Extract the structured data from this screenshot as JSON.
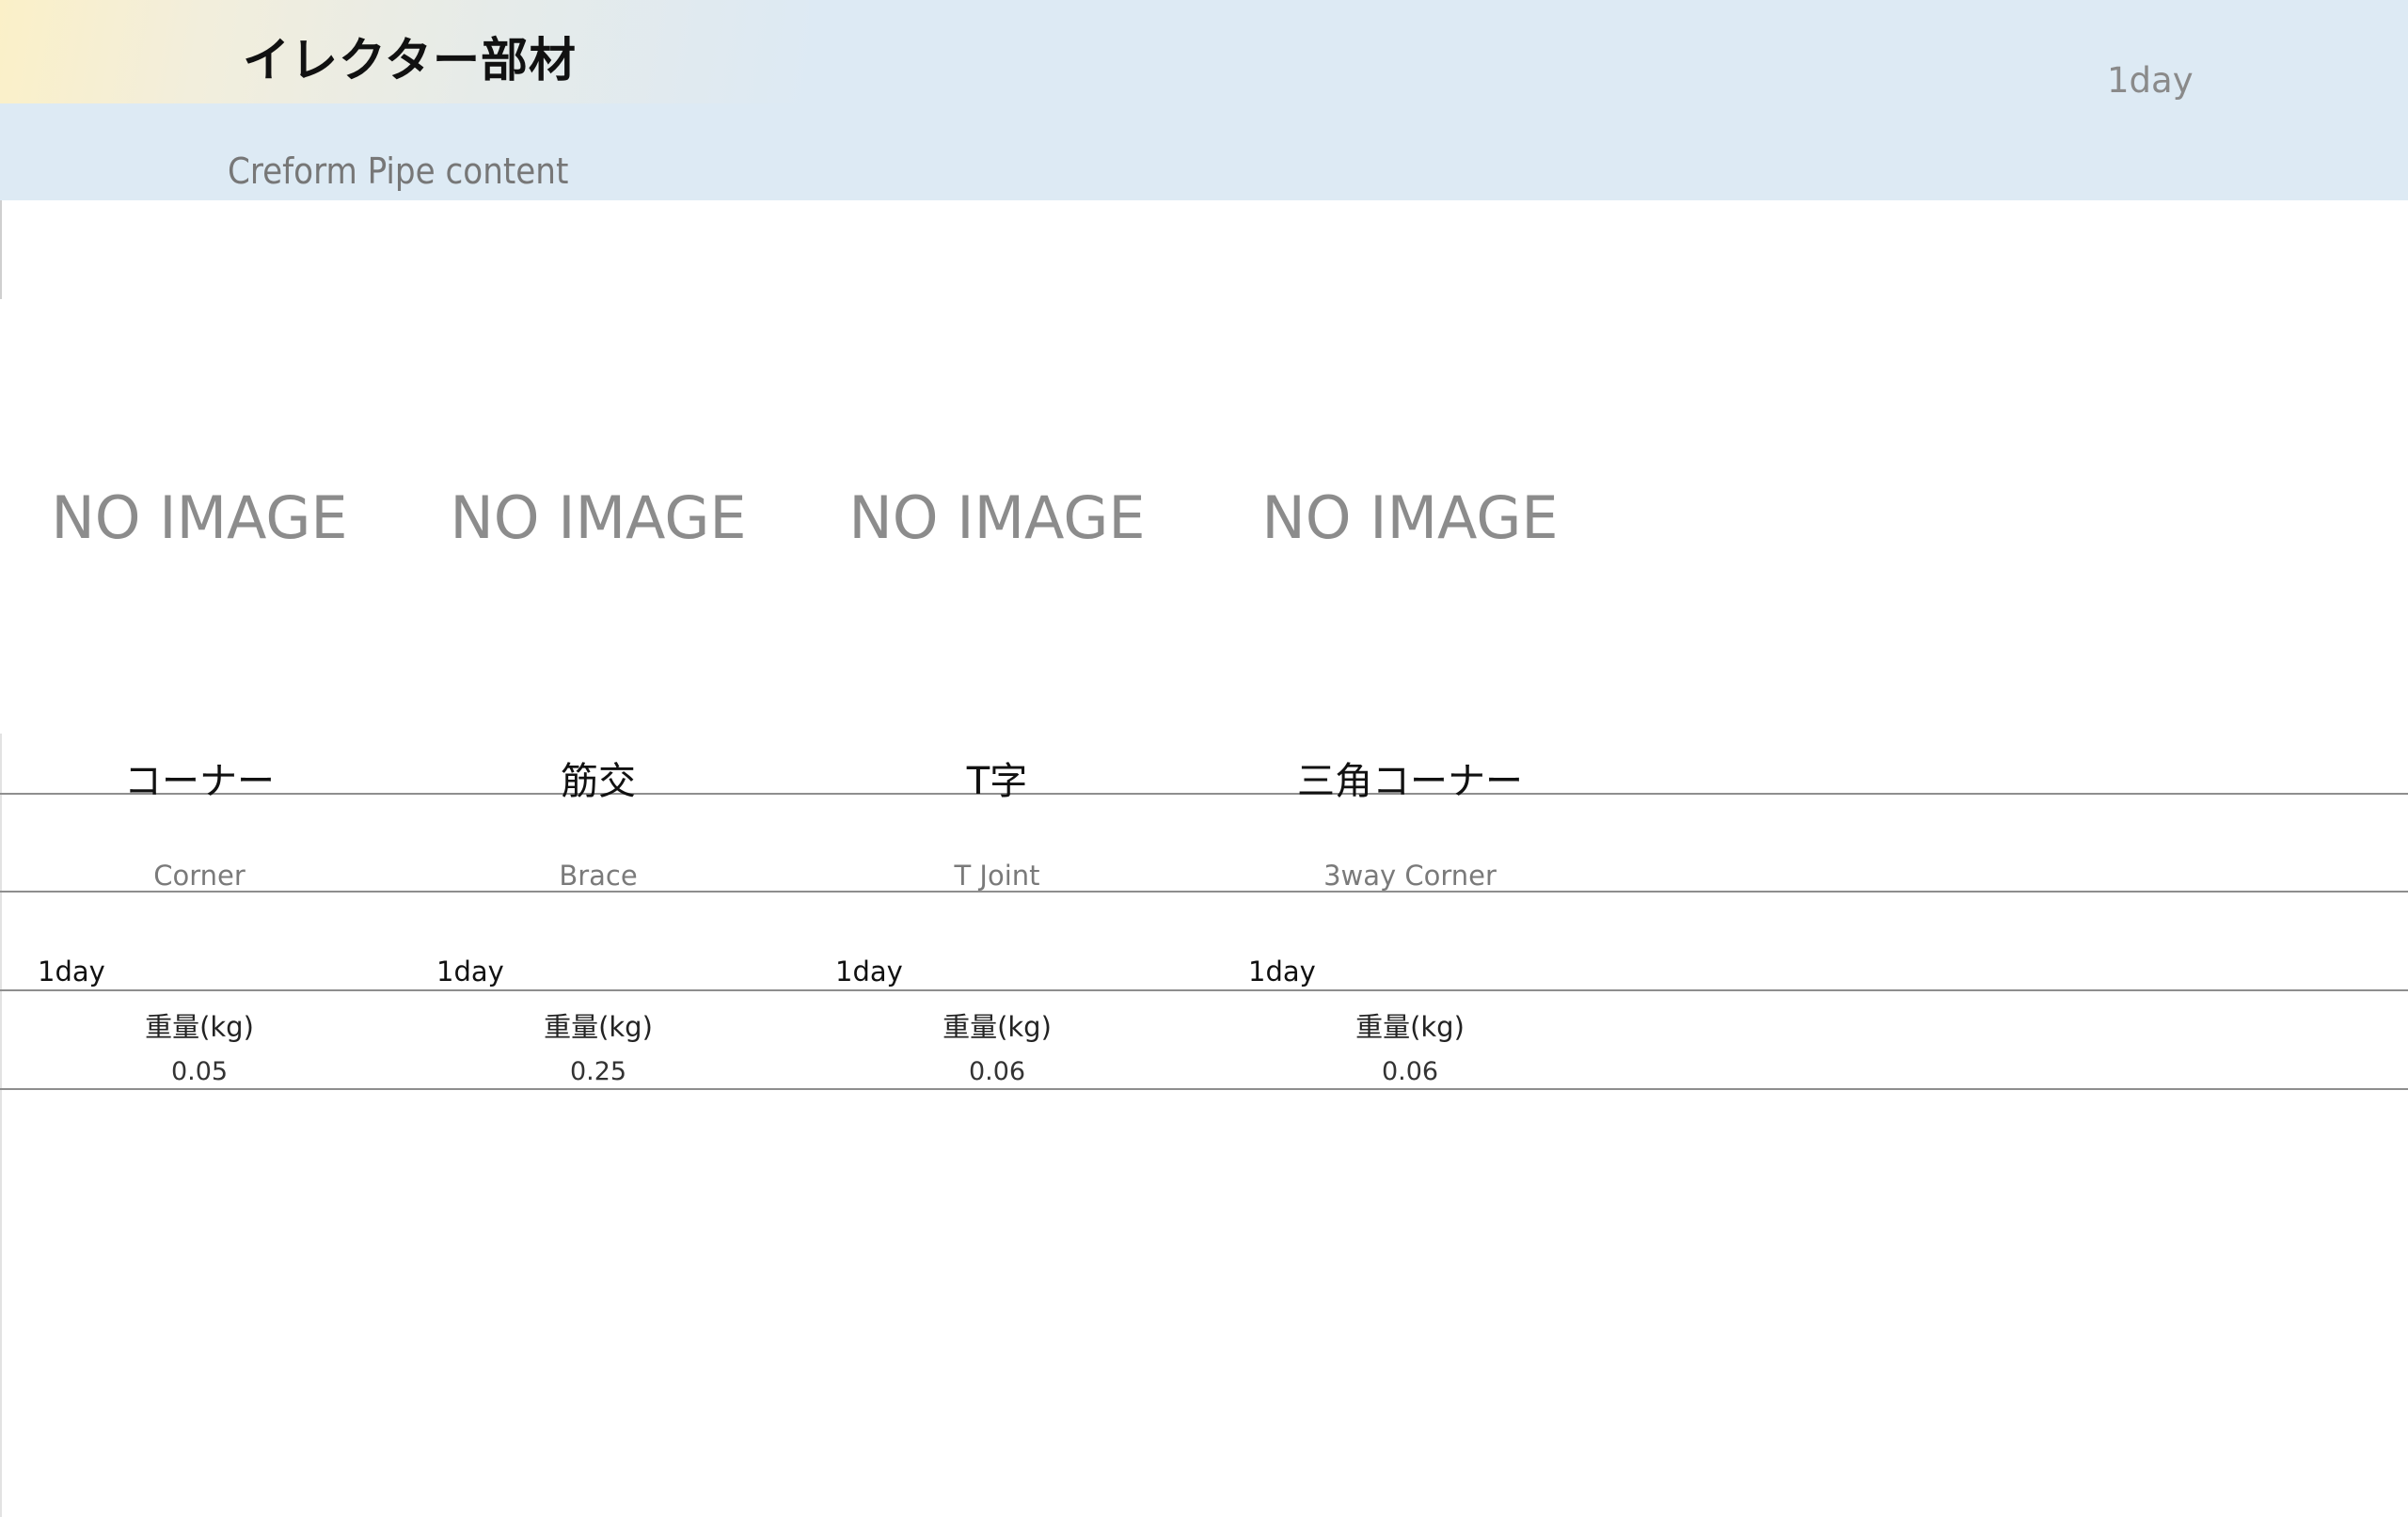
{
  "header": {
    "title": "イレクター部材",
    "subtitle": "Creform Pipe content",
    "lead_time": "1day"
  },
  "products": [
    {
      "image_placeholder": "NO IMAGE",
      "name_ja": "コーナー",
      "name_en": "Corner",
      "lead_time": "1day",
      "weight_label": "重量(kg)",
      "weight_value": "0.05"
    },
    {
      "image_placeholder": "NO IMAGE",
      "name_ja": "筋交",
      "name_en": "Brace",
      "lead_time": "1day",
      "weight_label": "重量(kg)",
      "weight_value": "0.25"
    },
    {
      "image_placeholder": "NO IMAGE",
      "name_ja": "T字",
      "name_en": "T Joint",
      "lead_time": "1day",
      "weight_label": "重量(kg)",
      "weight_value": "0.06"
    },
    {
      "image_placeholder": "NO IMAGE",
      "name_ja": "三角コーナー",
      "name_en": "3way Corner",
      "lead_time": "1day",
      "weight_label": "重量(kg)",
      "weight_value": "0.06"
    }
  ]
}
